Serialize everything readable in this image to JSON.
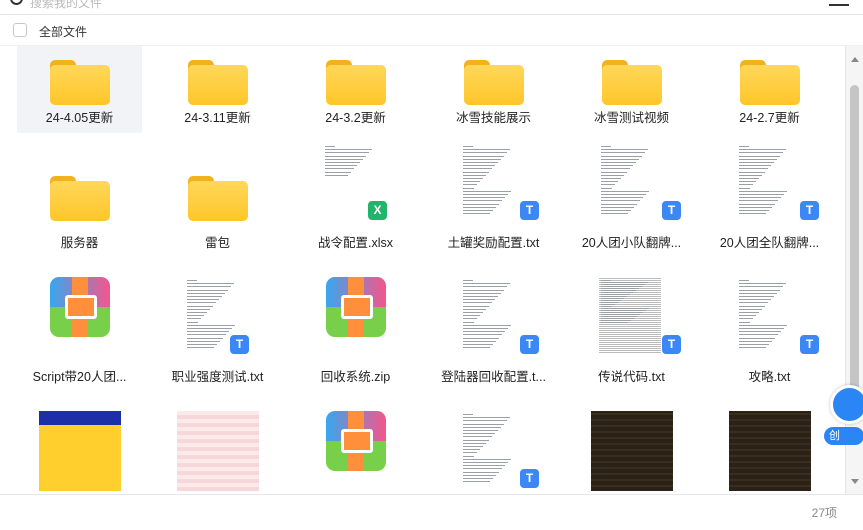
{
  "header": {
    "search_placeholder": "搜索我的文件"
  },
  "select_all": {
    "label": "全部文件"
  },
  "rows": [
    [
      {
        "name": "24-4.05更新",
        "type": "folder",
        "selected": true
      },
      {
        "name": "24-3.11更新",
        "type": "folder"
      },
      {
        "name": "24-3.2更新",
        "type": "folder"
      },
      {
        "name": "冰雪技能展示",
        "type": "folder"
      },
      {
        "name": "冰雪测试视频",
        "type": "folder"
      },
      {
        "name": "24-2.7更新",
        "type": "folder"
      }
    ],
    [
      {
        "name": "服务器",
        "type": "folder"
      },
      {
        "name": "雷包",
        "type": "folder"
      },
      {
        "name": "战令配置.xlsx",
        "type": "xlsx"
      },
      {
        "name": "土罐奖励配置.txt",
        "type": "txt"
      },
      {
        "name": "20人团小队翻牌...",
        "type": "txt"
      },
      {
        "name": "20人团全队翻牌...",
        "type": "txt"
      }
    ],
    [
      {
        "name": "Script带20人团...",
        "type": "zip"
      },
      {
        "name": "职业强度测试.txt",
        "type": "txt"
      },
      {
        "name": "回收系统.zip",
        "type": "zip"
      },
      {
        "name": "登陆器回收配置.t...",
        "type": "txt"
      },
      {
        "name": "传说代码.txt",
        "type": "txt"
      },
      {
        "name": "攻略.txt",
        "type": "txt"
      }
    ],
    [
      {
        "name": "",
        "type": "image-yellow"
      },
      {
        "name": "",
        "type": "image-pink"
      },
      {
        "name": "",
        "type": "zip"
      },
      {
        "name": "",
        "type": "txt"
      },
      {
        "name": "",
        "type": "image-dark"
      },
      {
        "name": "",
        "type": "image-dark2"
      }
    ]
  ],
  "badges": {
    "txt": "T",
    "xlsx": "X"
  },
  "floating_button": {
    "label": "创"
  },
  "footer": {
    "count": "27项"
  },
  "colors": {
    "folder": "#ffc629",
    "txt_badge": "#3a87f5",
    "xls_badge": "#23b46b",
    "accent": "#2a86f5"
  }
}
